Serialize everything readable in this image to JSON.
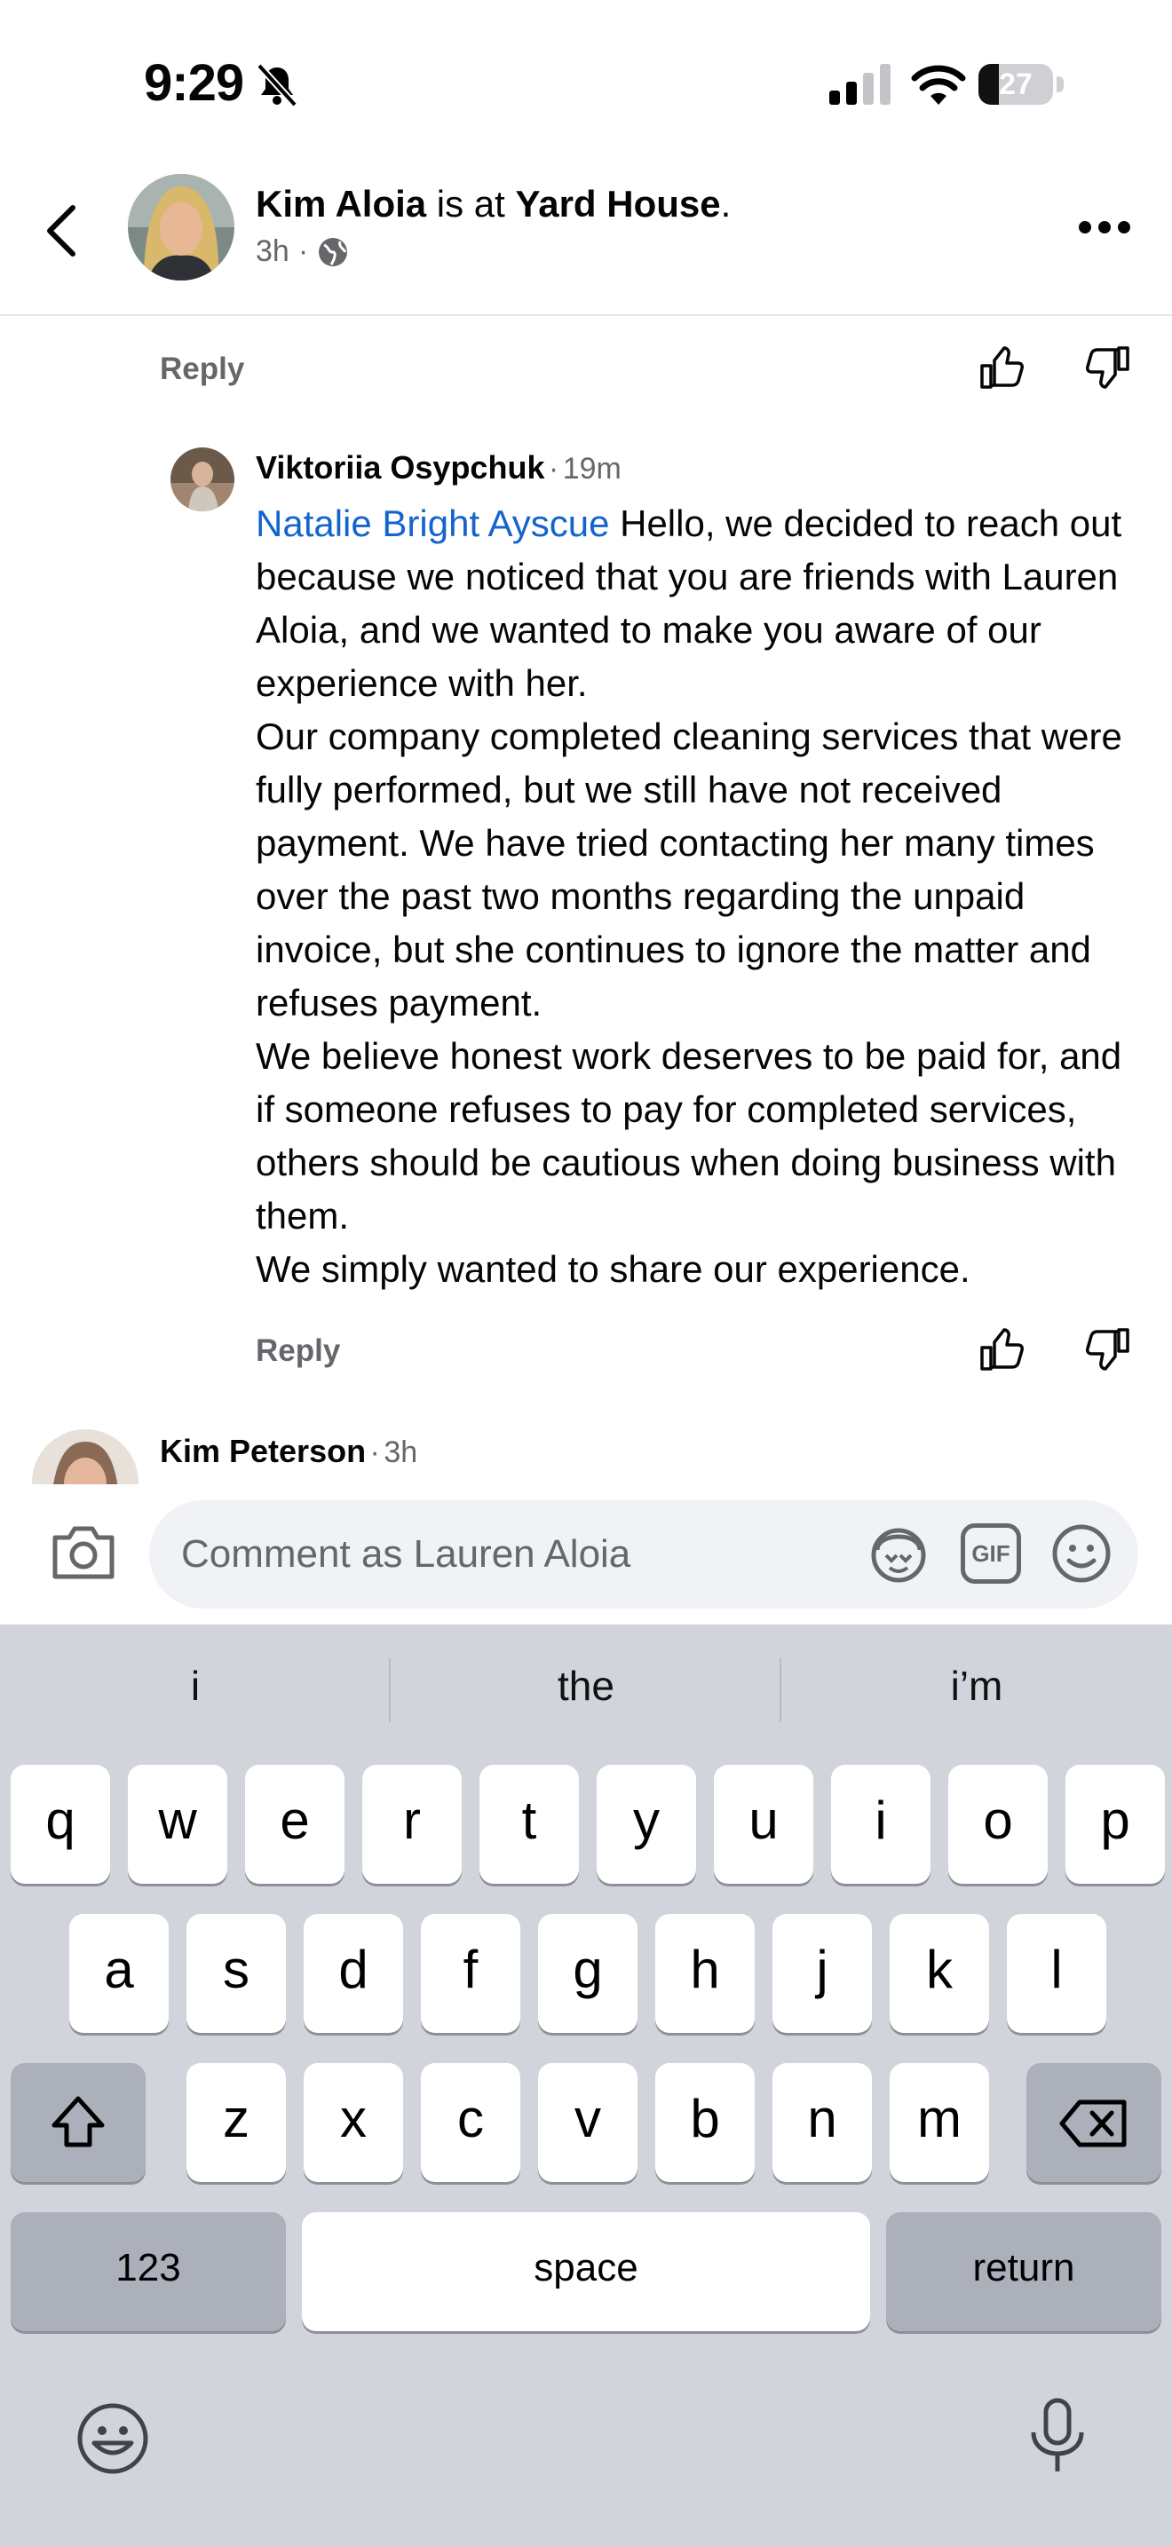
{
  "status": {
    "time": "9:29",
    "battery": "27",
    "battery_level": 0.27
  },
  "header": {
    "name": "Kim Aloia",
    "connector": " is at ",
    "place": "Yard House",
    "period": ".",
    "time": "3h",
    "separator": "·",
    "audience_icon": "globe-icon"
  },
  "top_comment_actions": {
    "reply": "Reply"
  },
  "comment": {
    "author": "Viktoriia Osypchuk",
    "dot": "·",
    "time": "19m",
    "mention": "Natalie Bright Ayscue",
    "para1": " Hello, we decided to reach out because we noticed that you are friends with Lauren Aloia, and we wanted to make you aware of our experience with her.",
    "para2": "Our company completed cleaning services that were fully performed, but we still have not received payment. We have tried contacting her many times over the past two months regarding the unpaid invoice, but she continues to ignore the matter and refuses payment.",
    "para3": "We believe honest work deserves to be paid for, and if someone refuses to pay for completed services, others should be cautious when doing business with them.",
    "para4": "We simply wanted to share our experience.",
    "reply": "Reply"
  },
  "next_comment": {
    "author": "Kim Peterson",
    "dot": "·",
    "time": "3h"
  },
  "composer": {
    "placeholder": "Comment as Lauren Aloia",
    "gif_label": "GIF"
  },
  "keyboard": {
    "suggestions": [
      "i",
      "the",
      "i’m"
    ],
    "row1": [
      "q",
      "w",
      "e",
      "r",
      "t",
      "y",
      "u",
      "i",
      "o",
      "p"
    ],
    "row2": [
      "a",
      "s",
      "d",
      "f",
      "g",
      "h",
      "j",
      "k",
      "l"
    ],
    "row3": [
      "z",
      "x",
      "c",
      "v",
      "b",
      "n",
      "m"
    ],
    "numbers": "123",
    "space": "space",
    "return": "return"
  }
}
